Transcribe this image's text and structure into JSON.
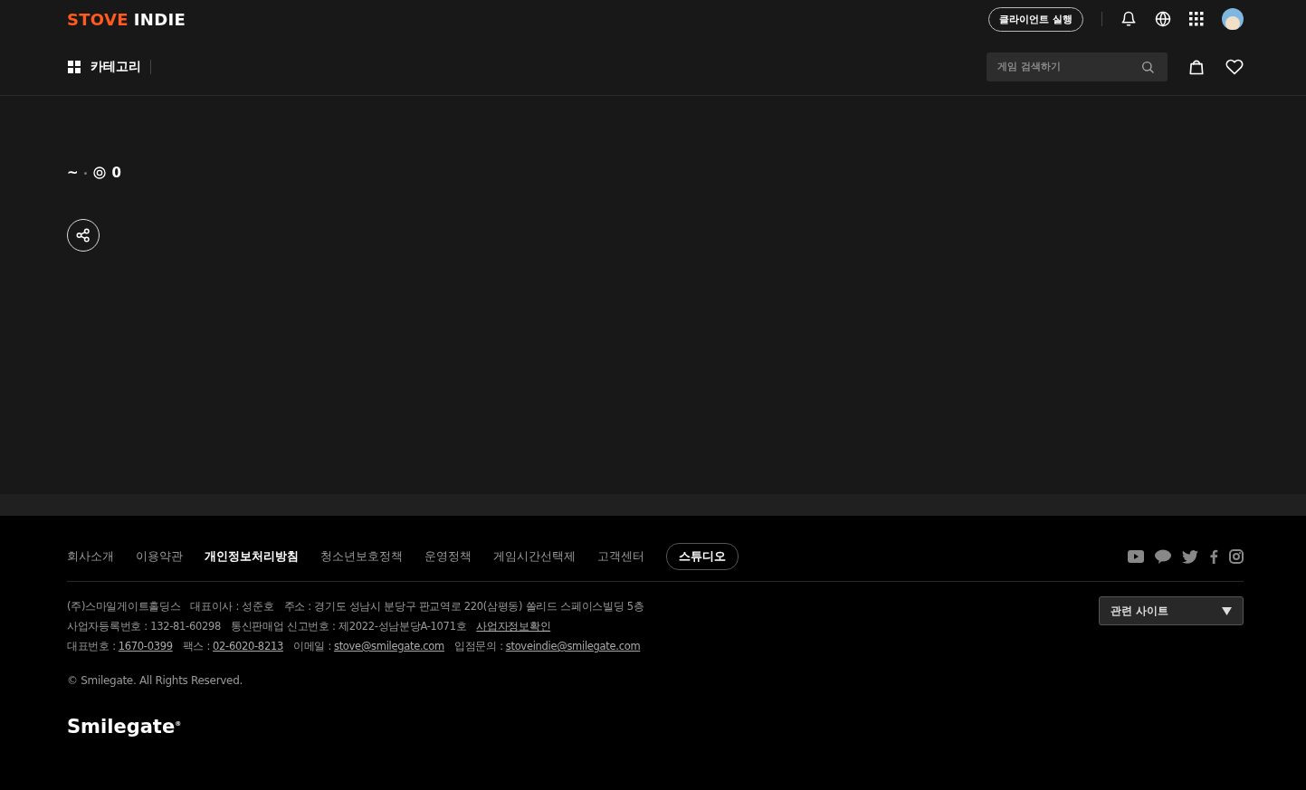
{
  "header": {
    "logo": {
      "part_1": "STOVE",
      "part_2": "INDIE"
    },
    "client_button": "클라이언트 실행",
    "category_label": "카테고리",
    "search": {
      "placeholder": "게임 검색하기"
    }
  },
  "meta": {
    "date": "~",
    "views": "0"
  },
  "footer": {
    "links": [
      {
        "label": "회사소개",
        "selected": false,
        "kind": "link"
      },
      {
        "label": "이용약관",
        "selected": false,
        "kind": "link"
      },
      {
        "label": "개인정보처리방침",
        "selected": true,
        "kind": "link"
      },
      {
        "label": "청소년보호정책",
        "selected": false,
        "kind": "link"
      },
      {
        "label": "운영정책",
        "selected": false,
        "kind": "link"
      },
      {
        "label": "게임시간선택제",
        "selected": false,
        "kind": "link"
      },
      {
        "label": "고객센터",
        "selected": false,
        "kind": "link"
      },
      {
        "label": "스튜디오",
        "selected": false,
        "kind": "pill"
      }
    ],
    "info_lines": [
      [
        {
          "label": "(주)스마일게이트홀딩스"
        },
        {
          "label": "대표이사 : 성준호"
        },
        {
          "label": "주소 : 경기도 성남시 분당구 판교역로 220(삼평동) 쏠리드 스페이스빌딩 5층"
        }
      ],
      [
        {
          "label": "사업자등록번호 : 132-81-60298"
        },
        {
          "label": "통신판매업 신고번호 : 제2022-성남분당A-1071호"
        },
        {
          "link": "사업자정보확인"
        }
      ],
      [
        {
          "label": "대표번호 :",
          "link": "1670-0399"
        },
        {
          "label": "팩스 :",
          "link": "02-6020-8213"
        },
        {
          "label": "이메일 :",
          "link": "stove@smilegate.com"
        },
        {
          "label": "입점문의 :",
          "link": "stoveindie@smilegate.com"
        }
      ]
    ],
    "copyright": "© Smilegate. All Rights Reserved.",
    "brand": "Smilegate$^{®}$",
    "related_sites": "관련 사이트"
  }
}
